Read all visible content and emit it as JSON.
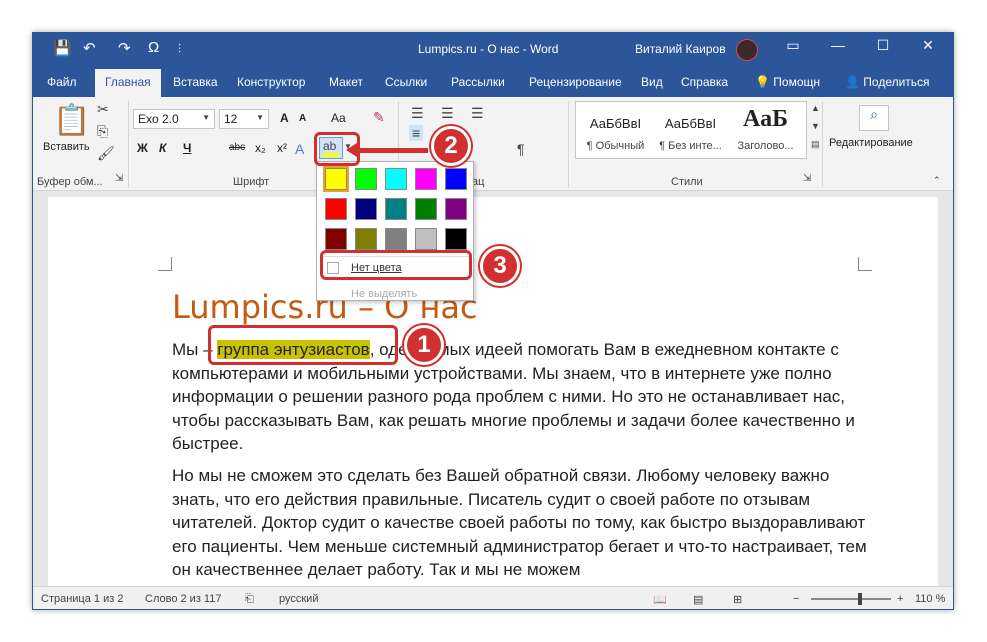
{
  "title_bar": {
    "title": "Lumpics.ru - О нас  -  Word",
    "user": "Виталий Каиров",
    "minimize": "—",
    "restore": "☐",
    "close": "✕",
    "ribbon_display": "▭",
    "qa_save": "💾",
    "qa_undo": "↶",
    "qa_redo": "↷",
    "qa_omega": "Ω",
    "qa_more": "⫶"
  },
  "tabs": [
    "Файл",
    "Главная",
    "Вставка",
    "Конструктор",
    "Макет",
    "Ссылки",
    "Рассылки",
    "Рецензирование",
    "Вид",
    "Справка",
    "Помощн",
    "Поделиться"
  ],
  "ribbon": {
    "paste_label": "Вставить",
    "clipboard_label": "Буфер обм...",
    "font_label": "Шрифт",
    "paragraph_label": "зац",
    "styles_label": "Стили",
    "editing_label": "Редактирование",
    "font_name": "Exo 2.0",
    "font_size": "12",
    "font_buttons": [
      "Ж",
      "К",
      "Ч",
      "abc",
      "x₂",
      "x²"
    ],
    "grow": "A",
    "shrink": "A",
    "case": "Aa",
    "styles": [
      {
        "sample": "АаБбВвІ",
        "name": "¶ Обычный"
      },
      {
        "sample": "АаБбВвІ",
        "name": "¶ Без инте..."
      },
      {
        "sample": "АаБ",
        "name": "Заголово..."
      }
    ]
  },
  "palette": {
    "colors": [
      "#ffff00",
      "#00ff00",
      "#00ffff",
      "#ff00ff",
      "#0000ff",
      "#ff0000",
      "#000080",
      "#008080",
      "#008000",
      "#800080",
      "#800000",
      "#808000",
      "#808080",
      "#c0c0c0",
      "#000000"
    ],
    "no_color": "Нет цвета",
    "stop": "Не выделять"
  },
  "document": {
    "heading": "Lumpics.ru – О нас",
    "p1_start": "Мы – ",
    "p1_highlight": "группа энтузиастов",
    "p1_rest": ", одержимых идеей помогать Вам в ежедневном контакте с компьютерами и мобильными устройствами. Мы знаем, что в интернете уже полно информации о решении разного рода проблем с ними. Но это не останавливает нас, чтобы рассказывать Вам, как решать многие проблемы и задачи более качественно и быстрее.",
    "p2": "Но мы не сможем это сделать без Вашей обратной связи. Любому человеку важно знать, что его действия правильные. Писатель судит о своей работе по отзывам читателей. Доктор судит о качестве своей работы по тому, как быстро выздоравливают его пациенты. Чем меньше системный администратор бегает и что-то настраивает, тем он качественнее делает работу. Так и мы не можем"
  },
  "status": {
    "page": "Страница 1 из 2",
    "words": "Слово 2 из 117",
    "lang": "русский",
    "zoom": "110 %",
    "zoom_level": 1.1,
    "minus": "−",
    "plus": "+"
  },
  "callouts": {
    "one": "1",
    "two": "2",
    "three": "3"
  },
  "colors": {
    "accent": "#2b579a",
    "highlight": "#c9c200",
    "callout": "#d03030",
    "heading": "#c55a11"
  }
}
